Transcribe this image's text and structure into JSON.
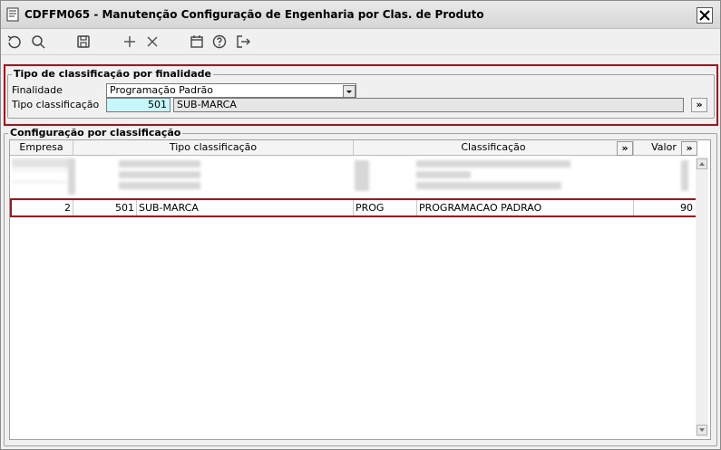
{
  "window": {
    "title": "CDFFM065 - Manutenção Configuração de Engenharia por Clas. de Produto",
    "close_label": "x"
  },
  "toolbar": {
    "icons": [
      "undo-icon",
      "search-icon",
      "save-icon",
      "add-icon",
      "delete-icon",
      "calendar-icon",
      "help-icon",
      "exit-icon"
    ]
  },
  "finalidade_group": {
    "title": "Tipo de classificação por finalidade",
    "finalidade_label": "Finalidade",
    "finalidade_value": "Programação Padrão",
    "tipo_label": "Tipo classificação",
    "tipo_code": "501",
    "tipo_desc": "SUB-MARCA",
    "expand_label": "»"
  },
  "config_group": {
    "title": "Configuração por classificação",
    "columns": {
      "empresa": "Empresa",
      "tipo": "Tipo classificação",
      "classificacao": "Classificação",
      "valor": "Valor",
      "expand": "»"
    },
    "selected_row": {
      "empresa": "2",
      "tipo_code": "501",
      "tipo_desc": "SUB-MARCA",
      "class_code": "PROG",
      "class_desc": "PROGRAMACAO PADRAO",
      "valor": "90"
    }
  },
  "colors": {
    "highlight_border": "#b00e18",
    "code_field_bg": "#c6f7fb"
  }
}
